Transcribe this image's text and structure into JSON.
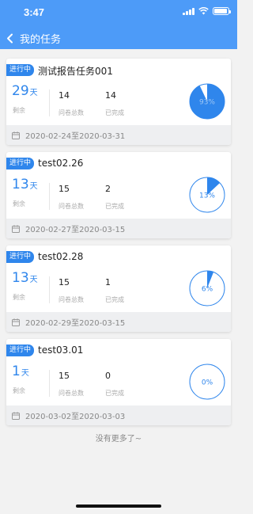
{
  "status_bar": {
    "time": "3:47"
  },
  "nav": {
    "title": "我的任务"
  },
  "labels": {
    "badge": "进行中",
    "day_unit": "天",
    "remaining": "剩余",
    "total": "问卷总数",
    "completed": "已完成"
  },
  "colors": {
    "primary": "#4d9bf8",
    "accent": "#2f86ec"
  },
  "tasks": [
    {
      "title": "测试报告任务001",
      "days_left": "29",
      "total": "14",
      "completed": "14",
      "percent_label": "93%",
      "percent": 93,
      "date_range": "2020-02-24至2020-03-31"
    },
    {
      "title": "test02.26",
      "days_left": "13",
      "total": "15",
      "completed": "2",
      "percent_label": "13%",
      "percent": 13,
      "date_range": "2020-02-27至2020-03-15"
    },
    {
      "title": "test02.28",
      "days_left": "13",
      "total": "15",
      "completed": "1",
      "percent_label": "6%",
      "percent": 6,
      "date_range": "2020-02-29至2020-03-15"
    },
    {
      "title": "test03.01",
      "days_left": "1",
      "total": "15",
      "completed": "0",
      "percent_label": "0%",
      "percent": 0,
      "date_range": "2020-03-02至2020-03-03"
    }
  ],
  "footer": {
    "no_more": "没有更多了~"
  }
}
